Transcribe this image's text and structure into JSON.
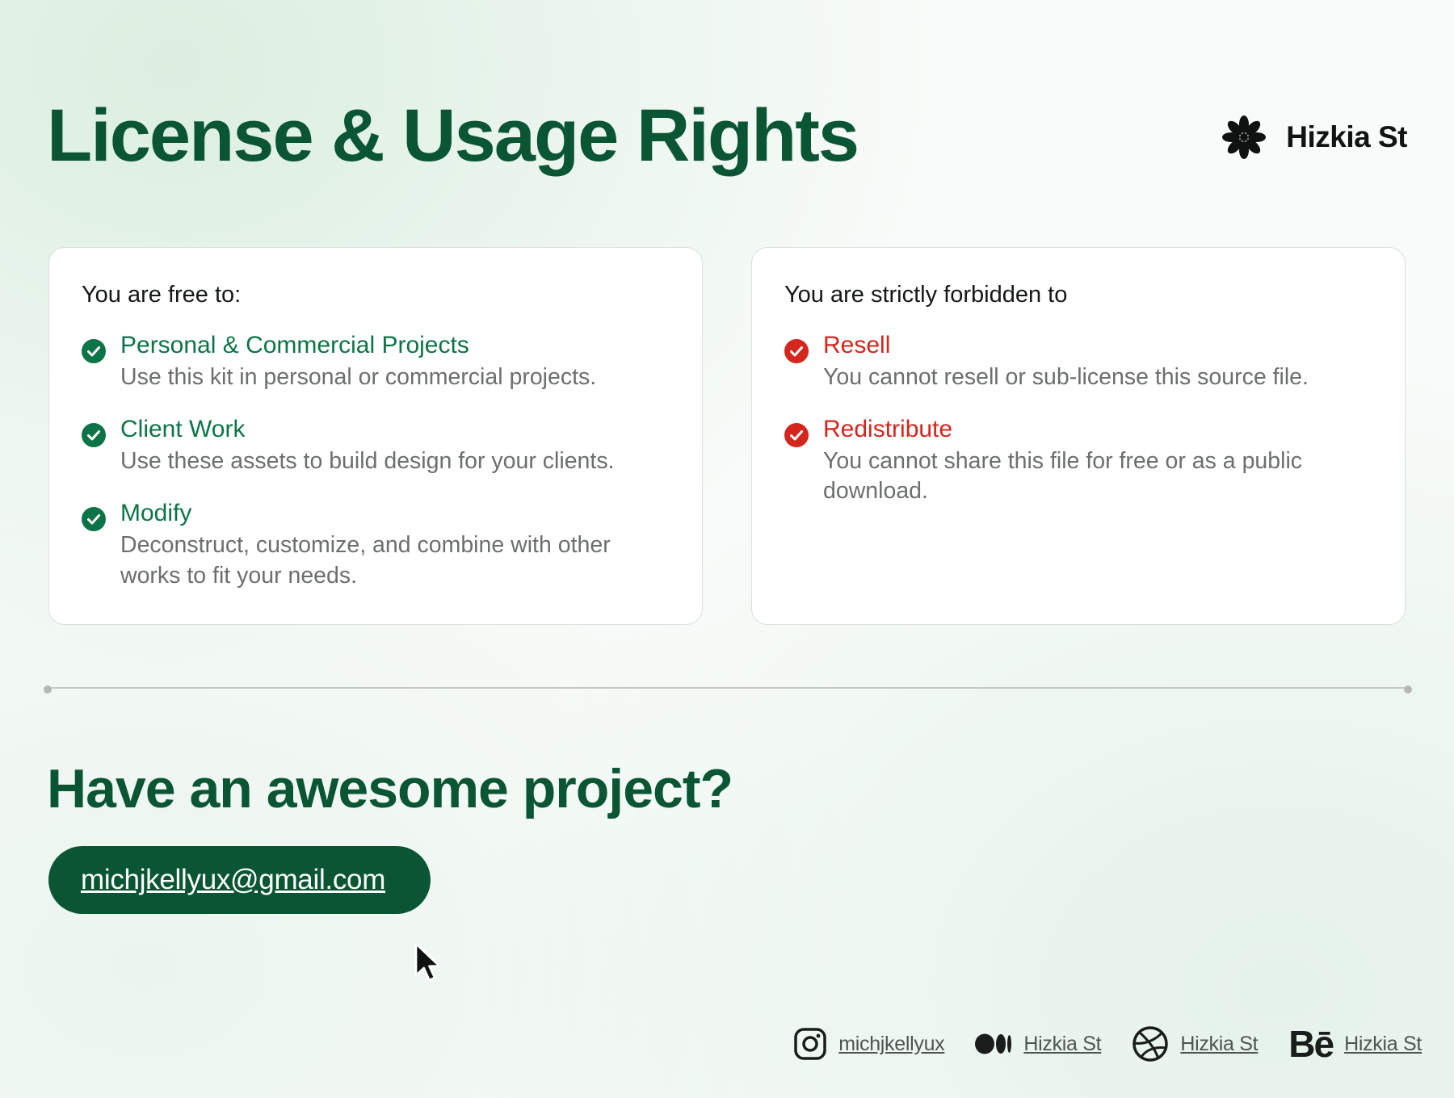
{
  "header": {
    "title": "License & Usage Rights",
    "brand_name": "Hizkia St",
    "brand_icon": "flower-logo-icon"
  },
  "colors": {
    "primary_green": "#0a5533",
    "allowed_green": "#0d7447",
    "forbidden_red": "#d3261d",
    "muted_text": "#6b6f6d"
  },
  "allowed": {
    "heading": "You are free to:",
    "items": [
      {
        "title": "Personal & Commercial Projects",
        "description": "Use this kit in personal or commercial projects.",
        "icon": "check-circle-icon"
      },
      {
        "title": "Client Work",
        "description": "Use these assets to build design for your clients.",
        "icon": "check-circle-icon"
      },
      {
        "title": "Modify",
        "description": "Deconstruct, customize, and combine with other works to fit your needs.",
        "icon": "check-circle-icon"
      }
    ]
  },
  "forbidden": {
    "heading": "You are strictly forbidden to",
    "items": [
      {
        "title": "Resell",
        "description": "You cannot resell or sub-license this source file.",
        "icon": "check-circle-icon"
      },
      {
        "title": "Redistribute",
        "description": "You cannot share this file for free or as a public download.",
        "icon": "check-circle-icon"
      }
    ]
  },
  "contact": {
    "heading": "Have an awesome project?",
    "email": "michjkellyux@gmail.com"
  },
  "socials": [
    {
      "platform": "instagram",
      "icon": "instagram-icon",
      "label": "michjkellyux"
    },
    {
      "platform": "medium",
      "icon": "medium-icon",
      "label": "Hizkia St"
    },
    {
      "platform": "dribbble",
      "icon": "dribbble-icon",
      "label": "Hizkia St"
    },
    {
      "platform": "behance",
      "icon": "behance-icon",
      "icon_glyph": "Bē",
      "label": "Hizkia St"
    }
  ]
}
